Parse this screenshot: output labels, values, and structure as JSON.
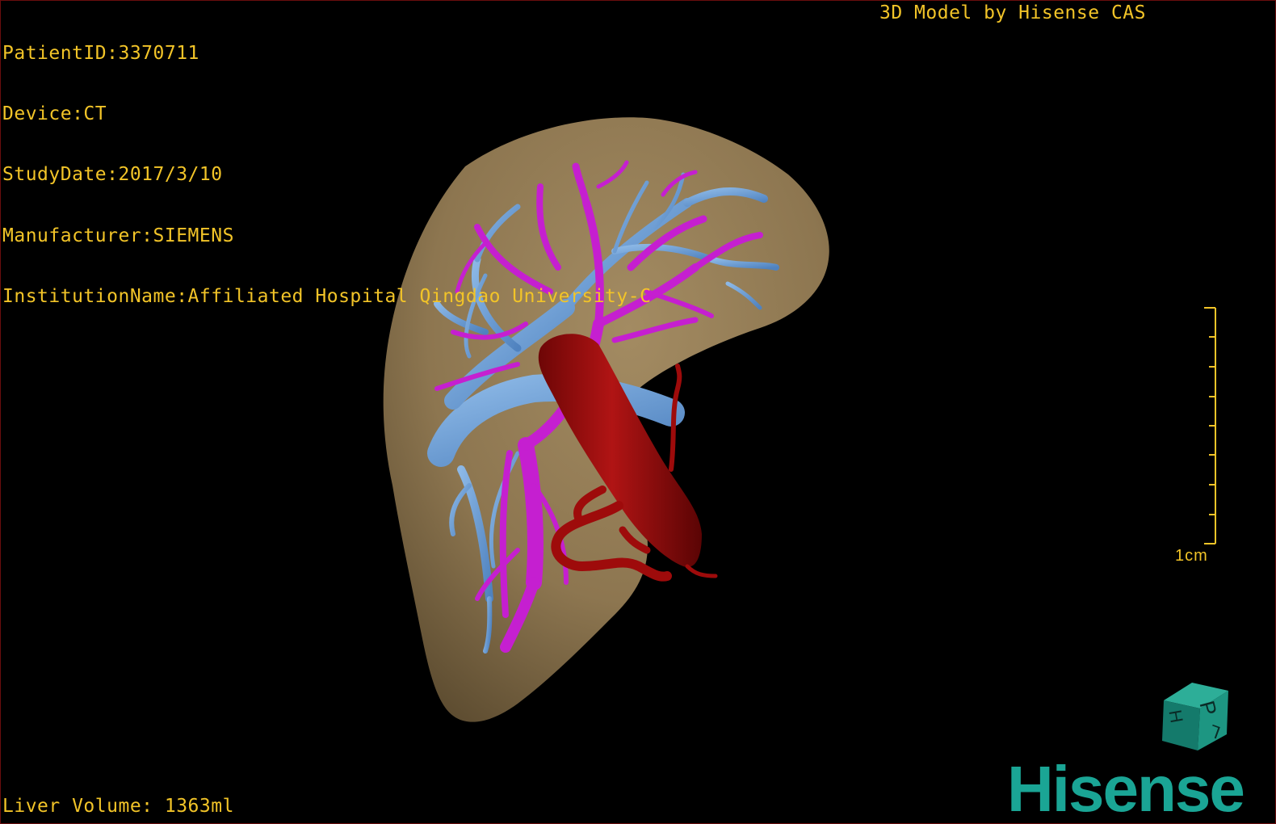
{
  "patient": {
    "patient_id": "PatientID:3370711",
    "device": "Device:CT",
    "study_date": "StudyDate:2017/3/10",
    "manufacturer": "Manufacturer:SIEMENS",
    "institution": "InstitutionName:Affiliated Hospital Qingdao University-C"
  },
  "credit": "3D Model by Hisense CAS",
  "measurements": {
    "liver_volume": "Liver Volume: 1363ml"
  },
  "scale_bar": {
    "label": "1cm"
  },
  "orientation_cube": {
    "face_top": "P",
    "face_left": "H",
    "face_right": "L"
  },
  "brand": {
    "name": "Hisense"
  },
  "colors": {
    "overlay_text": "#f2c428",
    "liver": "#8d7650",
    "hepatic_vein": "#6c9ed6",
    "portal_vein": "#c51fd0",
    "artery": "#9e0b0b",
    "brand": "#1aa595",
    "background": "#000000"
  },
  "structures": [
    "liver-surface",
    "hepatic-vein",
    "portal-vein",
    "vena-cava"
  ]
}
